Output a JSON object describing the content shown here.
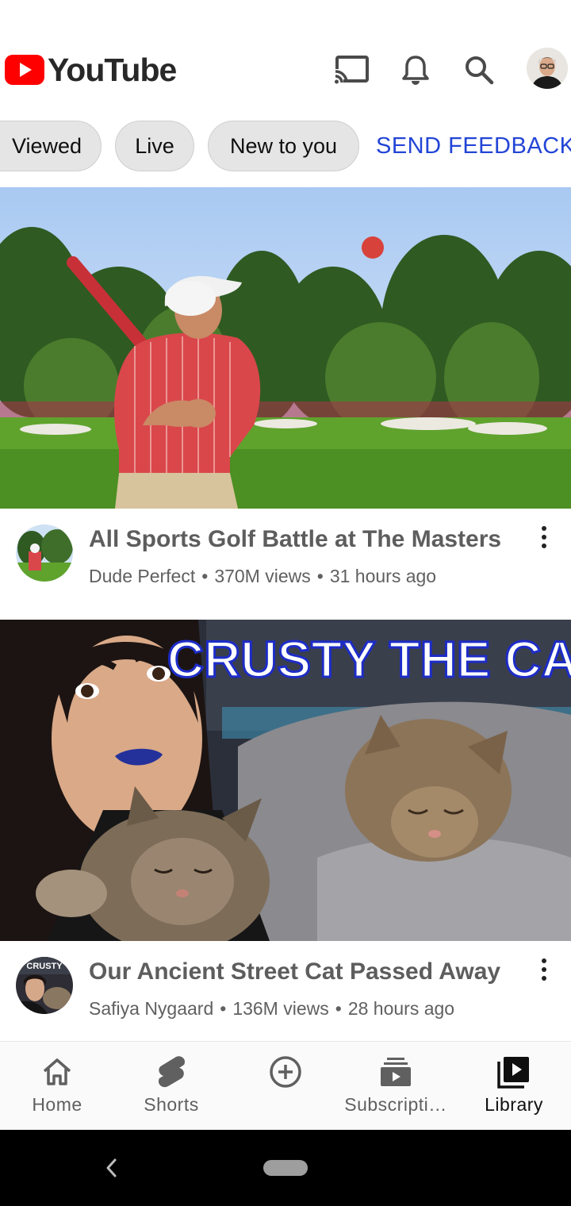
{
  "app": {
    "name": "YouTube"
  },
  "header": {
    "icons": [
      "cast-icon",
      "notifications-icon",
      "search-icon",
      "account-avatar"
    ]
  },
  "chips": [
    {
      "label": "Viewed"
    },
    {
      "label": "Live"
    },
    {
      "label": "New to you"
    }
  ],
  "send_feedback": "SEND FEEDBACK",
  "videos": [
    {
      "title": "All Sports Golf Battle at The Masters",
      "channel": "Dude Perfect",
      "views": "370M views",
      "age": "31 hours ago"
    },
    {
      "title": "Our Ancient Street Cat Passed Away",
      "thumbnail_text": "CRUSTY THE CAT",
      "avatar_text": "CRUSTY",
      "channel": "Safiya Nygaard",
      "views": "136M views",
      "age": "28 hours ago"
    }
  ],
  "bottom_nav": [
    {
      "label": "Home",
      "icon": "home-icon"
    },
    {
      "label": "Shorts",
      "icon": "shorts-icon"
    },
    {
      "label": "",
      "icon": "create-icon"
    },
    {
      "label": "Subscripti…",
      "icon": "subscriptions-icon"
    },
    {
      "label": "Library",
      "icon": "library-icon",
      "active": true
    }
  ],
  "colors": {
    "brand": "#ff0000",
    "link": "#2345d6"
  }
}
